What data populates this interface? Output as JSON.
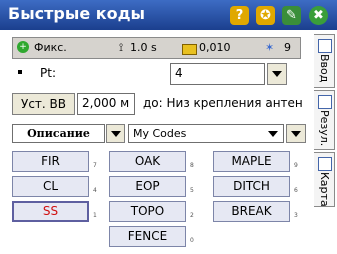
{
  "title": "Быстрые коды",
  "toolbar_icons": [
    {
      "name": "help-icon",
      "glyph": "?",
      "color": "#e0a800"
    },
    {
      "name": "star-icon",
      "glyph": "✪",
      "color": "#e0a800"
    },
    {
      "name": "edit-icon",
      "glyph": "✎",
      "color": "#3a8e3a"
    },
    {
      "name": "close-icon",
      "glyph": "✖",
      "color": "#3a9e3a"
    }
  ],
  "status": {
    "fix_label": "Фикс.",
    "interval": "1.0 s",
    "precision": "0,010",
    "satellites": "9"
  },
  "point": {
    "label": "Pt:",
    "value": "4"
  },
  "antenna": {
    "button_label": "Уст. ВВ",
    "height_value": "2,000 м",
    "measure_to": "до: Низ крепления антен"
  },
  "description": {
    "label": "Описание",
    "library_value": "My Codes"
  },
  "codes": [
    {
      "label": "FIR",
      "num": "7"
    },
    {
      "label": "OAK",
      "num": "8"
    },
    {
      "label": "MAPLE",
      "num": "9"
    },
    {
      "label": "CL",
      "num": "4"
    },
    {
      "label": "EOP",
      "num": "5"
    },
    {
      "label": "DITCH",
      "num": "6"
    },
    {
      "label": "SS",
      "num": "1"
    },
    {
      "label": "TOPO",
      "num": "2"
    },
    {
      "label": "BREAK",
      "num": "3"
    },
    {
      "label": "FENCE",
      "num": "0"
    }
  ],
  "side_tabs": [
    {
      "label": "Ввод"
    },
    {
      "label": "Резул."
    },
    {
      "label": "Карта"
    }
  ],
  "colors": {
    "accent": "#1b3f8e",
    "code_active_text": "#d01010"
  }
}
